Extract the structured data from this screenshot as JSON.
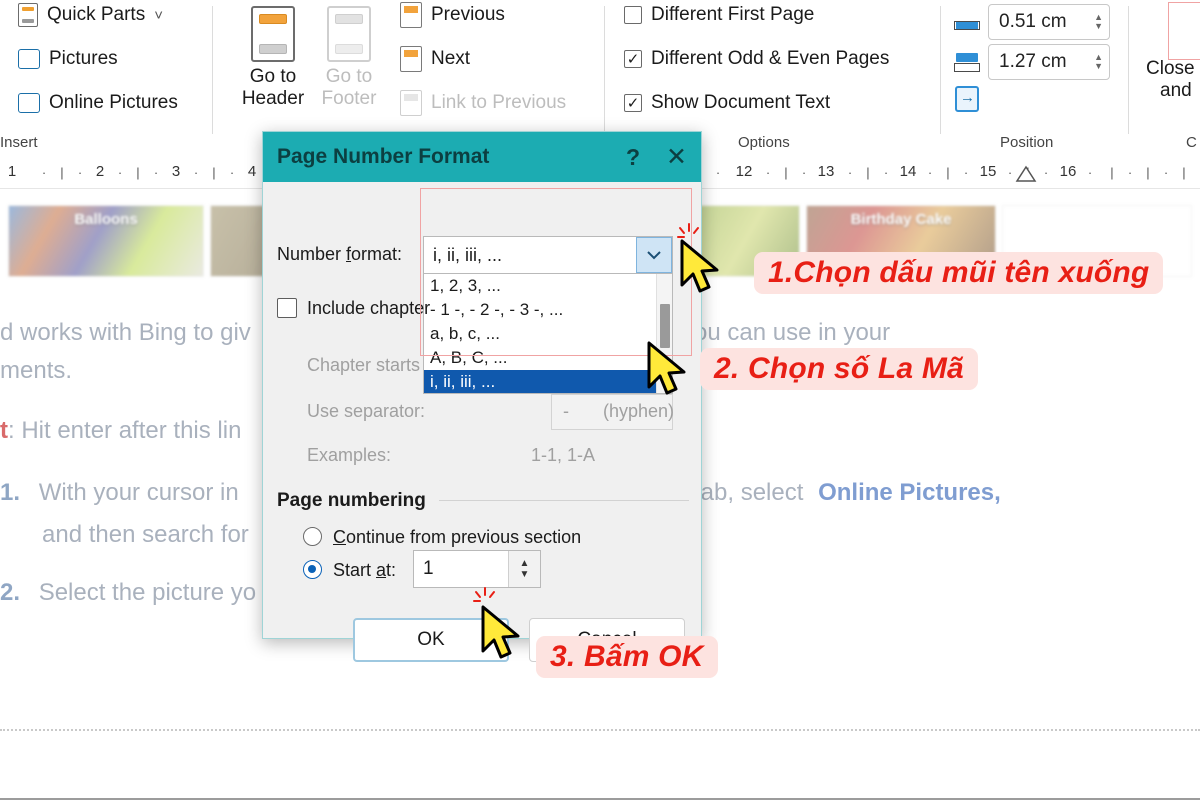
{
  "ribbon": {
    "groups": [
      {
        "label": "Insert"
      },
      {
        "label": "Options"
      },
      {
        "label": "Position"
      },
      {
        "label": "C"
      }
    ],
    "insert_group": {
      "items": [
        {
          "label": "Quick Parts",
          "icon": "quick-parts-icon",
          "caret": "˅"
        },
        {
          "label": "Pictures",
          "icon": "pictures-icon"
        },
        {
          "label": "Online Pictures",
          "icon": "online-pictures-icon"
        }
      ]
    },
    "navigation_group": {
      "go_to_header": "Go to\nHeader",
      "go_to_header_line1": "Go to",
      "go_to_header_line2": "Header",
      "go_to_footer_line1": "Go to",
      "go_to_footer_line2": "Footer",
      "previous": "Previous",
      "next": "Next",
      "link_to_previous": "Link to Previous"
    },
    "options_group": {
      "items": [
        {
          "label": "Different First Page",
          "checked": false
        },
        {
          "label": "Different Odd & Even Pages",
          "checked": true
        },
        {
          "label": "Show Document Text",
          "checked": true
        }
      ],
      "check_glyph": "✓"
    },
    "position_group": {
      "header_from_top": "0.51 cm",
      "footer_from_bottom": "1.27 cm",
      "insert_alignment_tab_icon": "insert-alignment-tab-icon"
    },
    "close_group": {
      "line1": "Close",
      "line2": "and",
      "line3": "C"
    }
  },
  "ruler": {
    "left_ticks": [
      "1",
      "2",
      "3",
      "4"
    ],
    "right_ticks": [
      "12",
      "13",
      "14",
      "15",
      "16"
    ]
  },
  "document": {
    "thumbnails": [
      {
        "caption": "Balloons"
      },
      {
        "caption": ""
      },
      {
        "caption": ""
      },
      {
        "caption": "Birthday Cake"
      }
    ],
    "lines": [
      {
        "text": "d works with Bing to giv"
      },
      {
        "text": "ments."
      },
      {
        "text": ": Hit enter after this lin"
      },
      {
        "text": "With your cursor in"
      },
      {
        "text": "and then search for"
      },
      {
        "text": "Select the picture yo"
      },
      {
        "text": "ou can use in your"
      },
      {
        "text": "tab, select"
      },
      {
        "text": "Online Pictures,"
      }
    ],
    "list_markers": [
      "1.",
      "2."
    ],
    "red_prefix": "t"
  },
  "dialog": {
    "title": "Page Number Format",
    "help_glyph": "?",
    "close_glyph": "✕",
    "number_format_label": "Number format:",
    "number_format_value": "i, ii, iii, ...",
    "number_format_options": [
      "1, 2, 3, ...",
      "- 1 -, - 2 -, - 3 -, ...",
      "a, b, c, ...",
      "A, B, C, ...",
      "i, ii, iii, ..."
    ],
    "number_format_selected_index": 4,
    "include_chapter_label": "Include chapter",
    "include_chapter_checked": false,
    "chapter_starts_label": "Chapter starts",
    "use_separator_label": "Use separator:",
    "separator_value": "-",
    "separator_name": "(hyphen)",
    "examples_label": "Examples:",
    "examples_value": "1-1, 1-A",
    "page_numbering_group": "Page numbering",
    "continue_label": "Continue from previous section",
    "continue_selected": false,
    "start_at_label": "Start at:",
    "start_at_selected": true,
    "start_at_value": "1",
    "ok_label": "OK",
    "cancel_label": "Cancel",
    "titlebar_color": "#1cacb2"
  },
  "annotations": [
    {
      "text": "1.Chọn dấu mũi tên xuống"
    },
    {
      "text": "2. Chọn số La Mã"
    },
    {
      "text": "3. Bấm OK"
    }
  ],
  "colors": {
    "dialog_title_bg": "#1cacb2",
    "annotation_text": "#e81f15",
    "annotation_bg": "#fde3e0",
    "dropdown_selection": "#1059ad",
    "cursor_fill": "#ffe93a",
    "accent_blue": "#0a62b8"
  }
}
